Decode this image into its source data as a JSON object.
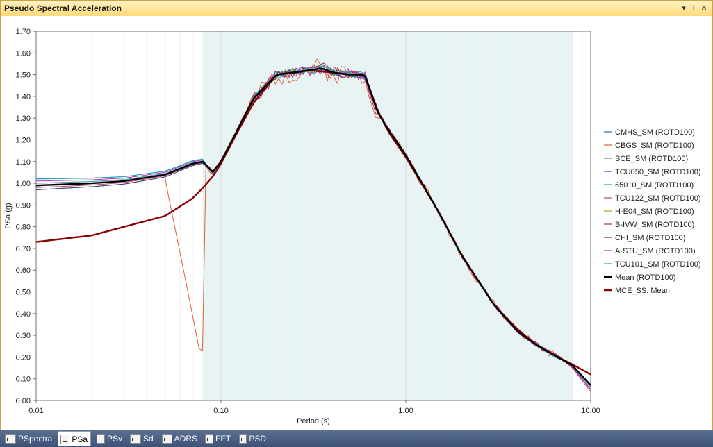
{
  "window": {
    "title": "Pseudo Spectral Acceleration",
    "controls": {
      "menu_icon": "dropdown-arrow",
      "pin_icon": "pin",
      "close_icon": "close"
    }
  },
  "tabs": [
    {
      "label": "PSpectra",
      "icon": "spectra-icon",
      "active": false
    },
    {
      "label": "PSa",
      "icon": "psa-icon",
      "active": true
    },
    {
      "label": "PSv",
      "icon": "psv-icon",
      "active": false
    },
    {
      "label": "Sd",
      "icon": "sd-icon",
      "active": false
    },
    {
      "label": "ADRS",
      "icon": "adrs-icon",
      "active": false
    },
    {
      "label": "FFT",
      "icon": "fft-icon",
      "active": false
    },
    {
      "label": "PSD",
      "icon": "psd-icon",
      "active": false
    }
  ],
  "chart_data": {
    "type": "line",
    "xlabel": "Period (s)",
    "ylabel": "PSa (g)",
    "x_scale": "log",
    "xlim": [
      0.01,
      10.0
    ],
    "ylim": [
      0.0,
      1.7
    ],
    "x_ticks": [
      "0.01",
      "0.10",
      "1.00",
      "10.00"
    ],
    "y_ticks": [
      "0.00",
      "0.10",
      "0.20",
      "0.30",
      "0.40",
      "0.50",
      "0.60",
      "0.70",
      "0.80",
      "0.90",
      "1.00",
      "1.10",
      "1.20",
      "1.30",
      "1.40",
      "1.50",
      "1.60",
      "1.70"
    ],
    "grid": "vertical log gridlines",
    "legend_position": "right",
    "shaded_range": {
      "x": [
        0.08,
        8.0
      ],
      "color": "#e8f4f4"
    },
    "mean": {
      "x": [
        0.01,
        0.02,
        0.03,
        0.05,
        0.07,
        0.08,
        0.09,
        0.1,
        0.12,
        0.15,
        0.2,
        0.25,
        0.3,
        0.35,
        0.4,
        0.5,
        0.6,
        0.7,
        0.8,
        1.0,
        1.5,
        2.0,
        3.0,
        4.0,
        5.0,
        6.0,
        8.0,
        10.0
      ],
      "y": [
        0.99,
        1.0,
        1.01,
        1.04,
        1.09,
        1.1,
        1.05,
        1.1,
        1.23,
        1.39,
        1.5,
        1.51,
        1.52,
        1.53,
        1.51,
        1.5,
        1.5,
        1.33,
        1.25,
        1.13,
        0.87,
        0.67,
        0.44,
        0.32,
        0.26,
        0.22,
        0.16,
        0.07
      ]
    },
    "mce": {
      "x": [
        0.01,
        0.02,
        0.03,
        0.05,
        0.07,
        0.08,
        0.09,
        0.1,
        0.12,
        0.15,
        0.2,
        0.3,
        0.4,
        0.5,
        0.6,
        0.7,
        0.8,
        1.0,
        1.5,
        2.0,
        3.0,
        4.0,
        5.0,
        6.0,
        8.0,
        10.0
      ],
      "y": [
        0.73,
        0.76,
        0.8,
        0.85,
        0.93,
        0.98,
        1.03,
        1.09,
        1.22,
        1.37,
        1.5,
        1.52,
        1.51,
        1.5,
        1.5,
        1.34,
        1.24,
        1.12,
        0.87,
        0.67,
        0.44,
        0.33,
        0.26,
        0.22,
        0.165,
        0.12
      ]
    },
    "series": [
      {
        "name": "CMHS_SM (ROTD100)",
        "color": "#3a6fb0",
        "offset": 0.03,
        "wiggle": 0.02,
        "seed": 1,
        "end": 0.06
      },
      {
        "name": "CBGS_SM (ROTD100)",
        "color": "#e06030",
        "offset": 0.01,
        "wiggle": 0.05,
        "seed": 2,
        "end": 0.05,
        "bump": 0.19
      },
      {
        "name": "SCE_SM (ROTD100)",
        "color": "#2e9a3a",
        "offset": 0.0,
        "wiggle": 0.015,
        "seed": 3,
        "end": 0.07
      },
      {
        "name": "TCU050_SM (ROTD100)",
        "color": "#8a2ab8",
        "offset": 0.0,
        "wiggle": 0.02,
        "seed": 4,
        "end": 0.05
      },
      {
        "name": "65010_SM (ROTD100)",
        "color": "#20a0b0",
        "offset": 0.03,
        "wiggle": 0.02,
        "seed": 5,
        "end": 0.07
      },
      {
        "name": "TCU122_SM (ROTD100)",
        "color": "#c04070",
        "offset": -0.01,
        "wiggle": 0.03,
        "seed": 6,
        "end": 0.04
      },
      {
        "name": "H-E04_SM (ROTD100)",
        "color": "#8ab020",
        "offset": 0.0,
        "wiggle": 0.015,
        "seed": 7,
        "end": 0.06
      },
      {
        "name": "B-IVW_SM (ROTD100)",
        "color": "#a03060",
        "offset": -0.02,
        "wiggle": 0.03,
        "seed": 8,
        "end": 0.05
      },
      {
        "name": "CHI_SM (ROTD100)",
        "color": "#304a70",
        "offset": -0.02,
        "wiggle": 0.015,
        "seed": 9,
        "end": 0.06
      },
      {
        "name": "A-STU_SM (ROTD100)",
        "color": "#b030c0",
        "offset": 0.02,
        "wiggle": 0.02,
        "seed": 10,
        "end": 0.05
      },
      {
        "name": "TCU101_SM (ROTD100)",
        "color": "#30a8b8",
        "offset": 0.01,
        "wiggle": 0.02,
        "seed": 11,
        "end": 0.06
      },
      {
        "name": "Mean (ROTD100)",
        "color": "#000000",
        "role": "mean"
      },
      {
        "name": "MCE_SS: Mean",
        "color": "#8b0000",
        "role": "mce"
      }
    ]
  }
}
